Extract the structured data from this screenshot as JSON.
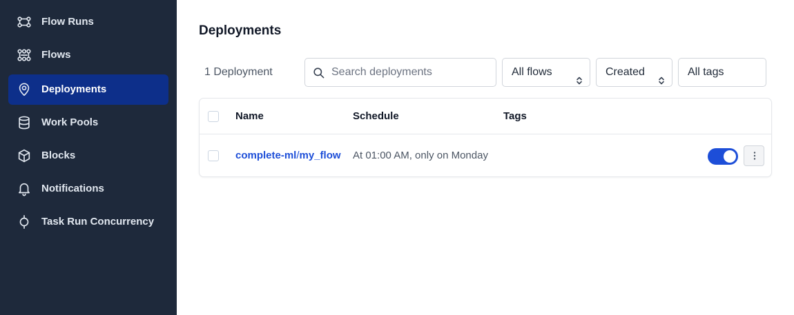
{
  "sidebar": {
    "items": [
      {
        "label": "Flow Runs",
        "icon": "flow-runs-icon"
      },
      {
        "label": "Flows",
        "icon": "flows-icon"
      },
      {
        "label": "Deployments",
        "icon": "location-pin-icon",
        "active": true
      },
      {
        "label": "Work Pools",
        "icon": "database-icon"
      },
      {
        "label": "Blocks",
        "icon": "cube-icon"
      },
      {
        "label": "Notifications",
        "icon": "bell-icon"
      },
      {
        "label": "Task Run Concurrency",
        "icon": "concurrency-icon"
      }
    ]
  },
  "page": {
    "title": "Deployments",
    "count_label": "1 Deployment"
  },
  "filters": {
    "search_placeholder": "Search deployments",
    "search_value": "",
    "flows_select": "All flows",
    "sort_select": "Created",
    "tags_select": "All tags"
  },
  "table": {
    "columns": [
      "Name",
      "Schedule",
      "Tags"
    ],
    "rows": [
      {
        "flow": "complete-ml",
        "separator": "/",
        "deployment": "my_flow",
        "schedule": "At 01:00 AM, only on Monday",
        "tags": [],
        "active": true
      }
    ]
  },
  "colors": {
    "sidebar_bg": "#1e293b",
    "active_item_bg": "#0d2f8a",
    "accent": "#1d4ed8"
  }
}
